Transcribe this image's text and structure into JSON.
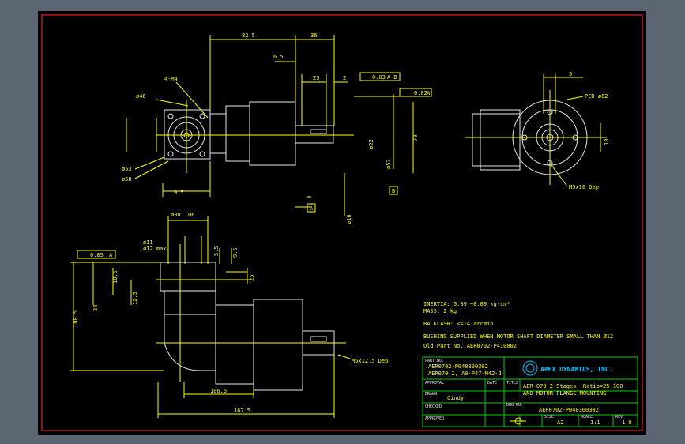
{
  "dims": {
    "d825": "82.5",
    "d36": "36",
    "d65": "6.5",
    "d25": "25",
    "d2": "2",
    "d95": "9.5",
    "d4m4": "4-M4",
    "d46": "ø46",
    "d53": "ø53",
    "d58": "ø58",
    "d52": "ø52",
    "d22": "ø22",
    "d70": "70",
    "d16": "ø16",
    "tol1": "0.03",
    "tol1ref": "A-B",
    "tol2": "0.02",
    "tol2ref": "A",
    "datumA": "A",
    "datumB": "B",
    "d5": "5",
    "pcd": "PCD ø62",
    "d18": "18",
    "m5x10": "M5x10 Dep",
    "d30": "ø30",
    "d06": "06",
    "d11": "ø11",
    "d12": "ø12 max.",
    "d55": "5.5",
    "dd95": "9.5",
    "d105": "10.5",
    "d24": "24",
    "d1005": "100.5",
    "d125": "12.5",
    "d25b": "25",
    "tol3": "0.05",
    "tol3ref": "A",
    "m5x125": "M5x12.5 Dep",
    "d1065": "106.5",
    "d1673": "167.5"
  },
  "notes": {
    "inertia": "INERTIA:  0.09 ~0.09  kg-cm²",
    "mass": "MASS: 2 kg",
    "backlash": "BACKLASH: <=14 arcmin",
    "bushing": "BUSHING SUPPLIED WHEN MOTOR SHAFT DIAMETER SMALL THAN Ø12",
    "oldpart": "Old Part No. AER0702-P410002"
  },
  "title_block": {
    "part_no_label": "PART NO.",
    "part_no_1": "AER0702-P040300302",
    "part_no_2": "AER070-2, A0-P47-M42-2",
    "approval_label": "APPROVAL",
    "date_label": "DATE",
    "drawn_label": "DRAWN",
    "drawn_by": "Cindy",
    "checked_label": "CHECKED",
    "approved_label": "APPROVED",
    "company": "APEX DYNAMICS, INC.",
    "title_label": "TITLE",
    "title_1": "AER-070 2 Stages, Ratio=25-100",
    "title_2": "AND MOTOR FLANGE MOUNTING",
    "dwg_no_label": "DWG NO.",
    "dwg_no": "AER0702-P040300302",
    "size_label": "SIZE",
    "size": "A2",
    "scale_label": "SCALE",
    "scale": "1:1",
    "rev_label": "REV",
    "rev": "1.0"
  },
  "colors": {
    "background": "#000000",
    "border": "#ff3030",
    "geometry": "#ffff00",
    "outline": "#e6e6e6",
    "title_block": "#00d000",
    "logo": "#00c8ff"
  }
}
